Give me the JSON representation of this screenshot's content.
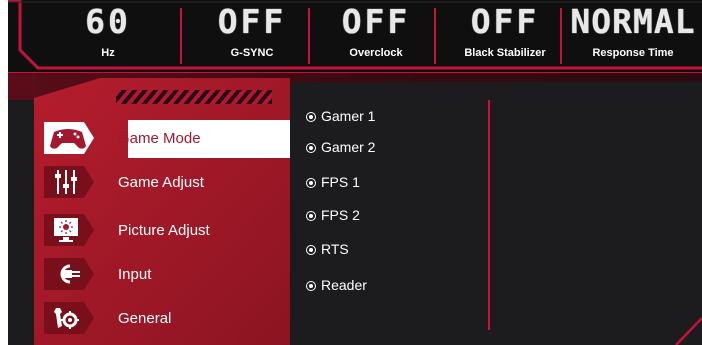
{
  "status_bar": {
    "items": [
      {
        "value": "60",
        "label": "Hz"
      },
      {
        "value": "OFF",
        "label": "G-SYNC"
      },
      {
        "value": "OFF",
        "label": "Overclock"
      },
      {
        "value": "OFF",
        "label": "Black Stabilizer"
      },
      {
        "value": "NORMAL",
        "label": "Response Time"
      }
    ]
  },
  "menu": {
    "items": [
      {
        "label": "Game Mode",
        "icon": "gamepad-icon",
        "selected": true
      },
      {
        "label": "Game Adjust",
        "icon": "sliders-icon",
        "selected": false
      },
      {
        "label": "Picture Adjust",
        "icon": "monitor-brightness-icon",
        "selected": false
      },
      {
        "label": "Input",
        "icon": "plug-icon",
        "selected": false
      },
      {
        "label": "General",
        "icon": "wrench-gear-icon",
        "selected": false
      }
    ]
  },
  "submenu": {
    "items": [
      {
        "label": "Gamer 1"
      },
      {
        "label": "Gamer 2"
      },
      {
        "label": "FPS 1"
      },
      {
        "label": "FPS 2"
      },
      {
        "label": "RTS"
      },
      {
        "label": "Reader"
      }
    ]
  },
  "colors": {
    "accent": "#c5123a",
    "panel_red": "#a61a2a",
    "background": "#1c1c1e",
    "text": "#ffffff"
  }
}
